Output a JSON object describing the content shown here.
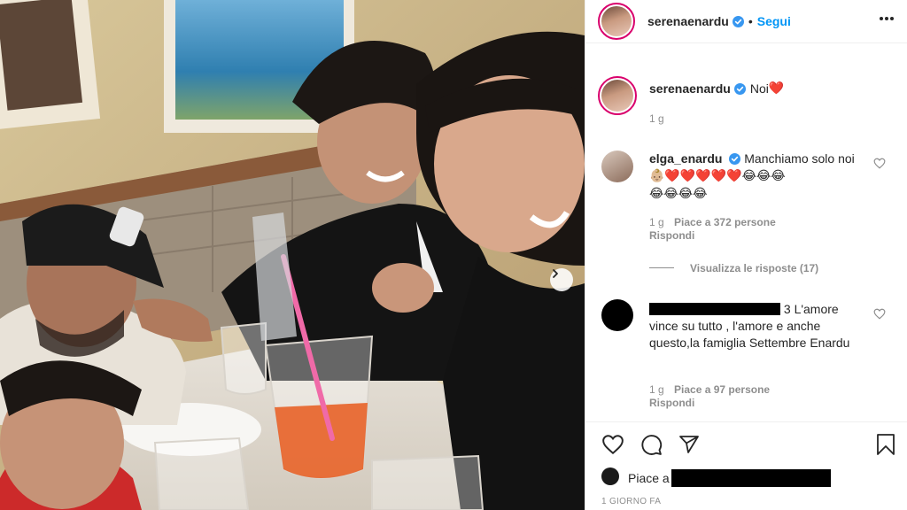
{
  "post": {
    "author": "serenaenardu",
    "follow_label": "Segui",
    "separator": "•",
    "caption_text": "Noi",
    "caption_emoji": "❤️",
    "caption_age": "1 g",
    "image_alt": "Family photo at a restaurant table",
    "carousel_next": "›"
  },
  "comments": [
    {
      "username": "elga_enardu",
      "verified": true,
      "text": "Manchiamo solo noi",
      "emojis_line1": "👶🏼❤️❤️❤️❤️❤️😂😂😂",
      "emojis_line2": "😂😂😂😂",
      "age": "1 g",
      "likes": "Piace a 372 persone",
      "reply": "Rispondi",
      "view_replies": "Visualizza le risposte (17)"
    },
    {
      "username": "",
      "username_redacted": true,
      "text_first": "3 L'amore",
      "text_rest": "vince su tutto , l'amore e anche questo,la famiglia Settembre Enardu",
      "age": "1 g",
      "likes": "Piace a 97 persone",
      "reply": "Rispondi"
    }
  ],
  "footer": {
    "likes_prefix": "Piace a",
    "timestamp": "1 GIORNO FA"
  },
  "icons": [
    "verified-icon",
    "more-icon",
    "heart-icon",
    "comment-icon",
    "share-icon",
    "bookmark-icon",
    "chevron-right-icon"
  ],
  "colors": {
    "link": "#0095f6",
    "verified": "#3897f0",
    "text": "#262626",
    "muted": "#8e8e8e",
    "heart": "#ed4956"
  }
}
